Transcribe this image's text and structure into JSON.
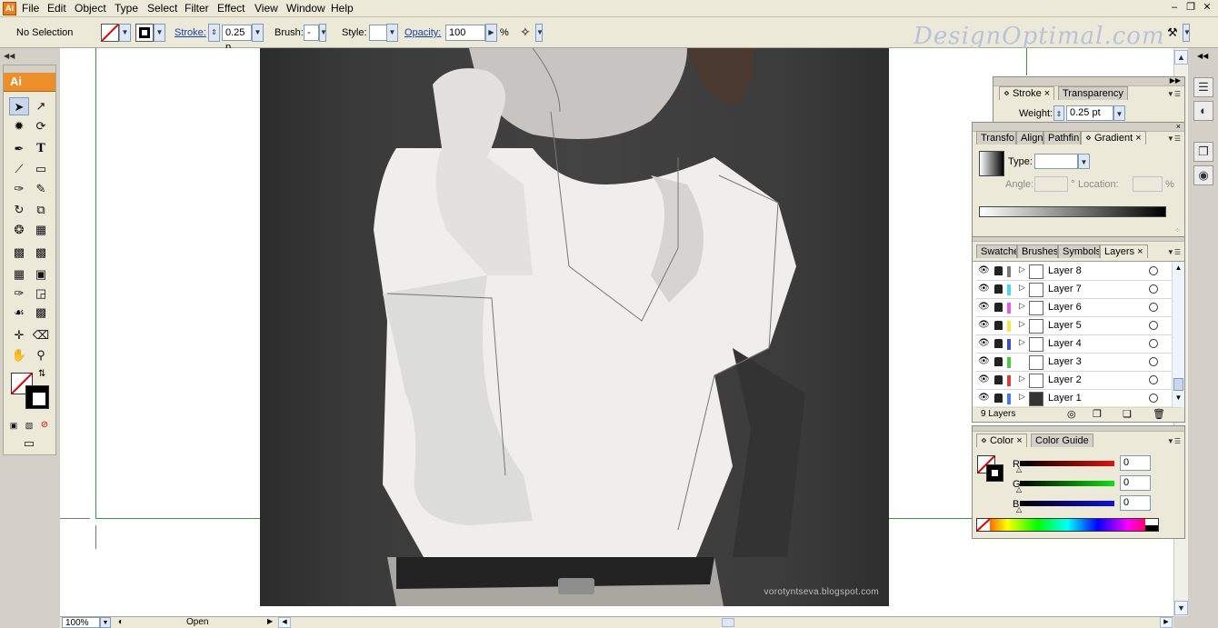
{
  "app": {
    "logo": "Ai",
    "brand_color": "#ec8f2a"
  },
  "menu": [
    "File",
    "Edit",
    "Object",
    "Type",
    "Select",
    "Filter",
    "Effect",
    "View",
    "Window",
    "Help"
  ],
  "window_controls": [
    "minimize-icon",
    "restore-icon",
    "close-icon"
  ],
  "control_bar": {
    "selection_status": "No Selection",
    "stroke_label": "Stroke:",
    "stroke_weight": "0.25 p",
    "brush_label": "Brush:",
    "brush_value": "-",
    "style_label": "Style:",
    "opacity_label": "Opacity:",
    "opacity_value": "100",
    "opacity_unit": "%"
  },
  "watermark": "DesignOptimal.com",
  "tools_panel": {
    "title": "Ai"
  },
  "canvas": {
    "photo_credit": "vorotyntseva.blogspot.com",
    "guide_color": "#3a9a3a"
  },
  "stroke_panel": {
    "tabs": [
      "Stroke",
      "Transparency"
    ],
    "weight_label": "Weight:",
    "weight_value": "0.25 pt"
  },
  "gradient_panel": {
    "tabs": [
      "Transfo",
      "Align",
      "Pathfin",
      "Gradient"
    ],
    "type_label": "Type:",
    "type_value": "",
    "angle_label": "Angle:",
    "angle_unit": "°",
    "location_label": "Location:",
    "location_unit": "%"
  },
  "layers_panel": {
    "tabs": [
      "Swatche",
      "Brushes",
      "Symbols",
      "Layers"
    ],
    "layers": [
      {
        "name": "Layer 8",
        "color": "#7a7a7a"
      },
      {
        "name": "Layer 7",
        "color": "#4fd6e8"
      },
      {
        "name": "Layer 6",
        "color": "#e65be6"
      },
      {
        "name": "Layer 5",
        "color": "#f0e84a"
      },
      {
        "name": "Layer 4",
        "color": "#3a4fc8"
      },
      {
        "name": "Layer 3",
        "color": "#4ac84a"
      },
      {
        "name": "Layer 2",
        "color": "#e03a3a"
      },
      {
        "name": "Layer 1",
        "color": "#4a7ae0"
      }
    ],
    "count_label": "9 Layers"
  },
  "color_panel": {
    "tabs": [
      "Color",
      "Color Guide"
    ],
    "channels": [
      {
        "label": "R",
        "value": "0",
        "color": "#c81e1e"
      },
      {
        "label": "G",
        "value": "0",
        "color": "#1ec81e"
      },
      {
        "label": "B",
        "value": "0",
        "color": "#1e1ec8"
      }
    ]
  },
  "status_bar": {
    "zoom": "100%",
    "status": "Open"
  }
}
